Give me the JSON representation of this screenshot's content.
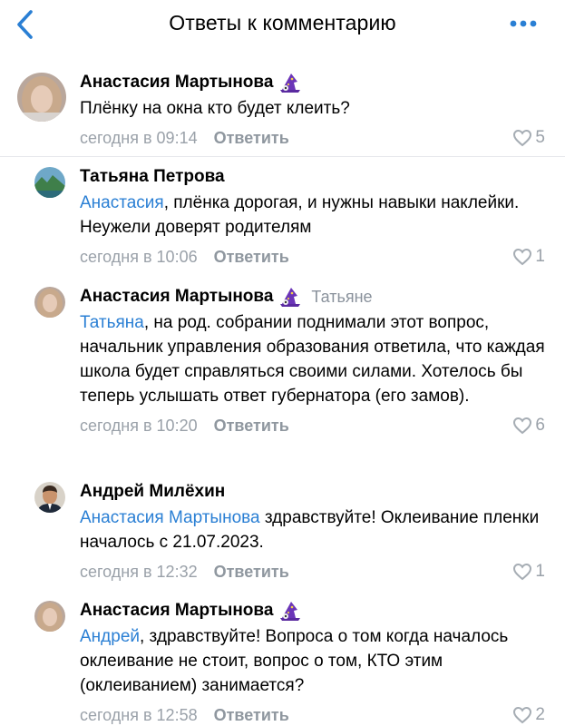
{
  "header": {
    "title": "Ответы к комментарию"
  },
  "colors": {
    "accent": "#2a7fd4",
    "meta": "#9aa1a9",
    "heart": "#a6adb4"
  },
  "comments": [
    {
      "author": "Анастасия Мартынова",
      "badge": "wizard-hat-icon",
      "reply_to": "",
      "mention": "",
      "text": "Плёнку на окна кто будет клеить?",
      "time": "сегодня в 09:14",
      "reply_label": "Ответить",
      "likes": "5"
    },
    {
      "author": "Татьяна Петрова",
      "badge": "",
      "reply_to": "",
      "mention": "Анастасия",
      "text": ", плёнка дорогая, и нужны навыки наклейки. Неужели доверят родителям",
      "time": "сегодня в 10:06",
      "reply_label": "Ответить",
      "likes": "1"
    },
    {
      "author": "Анастасия Мартынова",
      "badge": "wizard-hat-icon",
      "reply_to": "Татьяне",
      "mention": "Татьяна",
      "text": ", на род. собрании поднимали этот вопрос, начальник управления образования ответила, что каждая школа будет справляться своими силами. Хотелось бы теперь услышать ответ губернатора (его замов).",
      "time": "сегодня в 10:20",
      "reply_label": "Ответить",
      "likes": "6"
    },
    {
      "author": "Андрей Милёхин",
      "badge": "",
      "reply_to": "",
      "mention": "Анастасия Мартынова",
      "text": " здравствуйте! Оклеивание пленки началось с 21.07.2023.",
      "time": "сегодня в 12:32",
      "reply_label": "Ответить",
      "likes": "1"
    },
    {
      "author": "Анастасия Мартынова",
      "badge": "wizard-hat-icon",
      "reply_to": "",
      "mention": "Андрей",
      "text": ", здравствуйте! Вопроса о том когда началось оклеивание не стоит, вопрос о том, КТО этим (оклеиванием) занимается?",
      "time": "сегодня в 12:58",
      "reply_label": "Ответить",
      "likes": "2"
    }
  ]
}
